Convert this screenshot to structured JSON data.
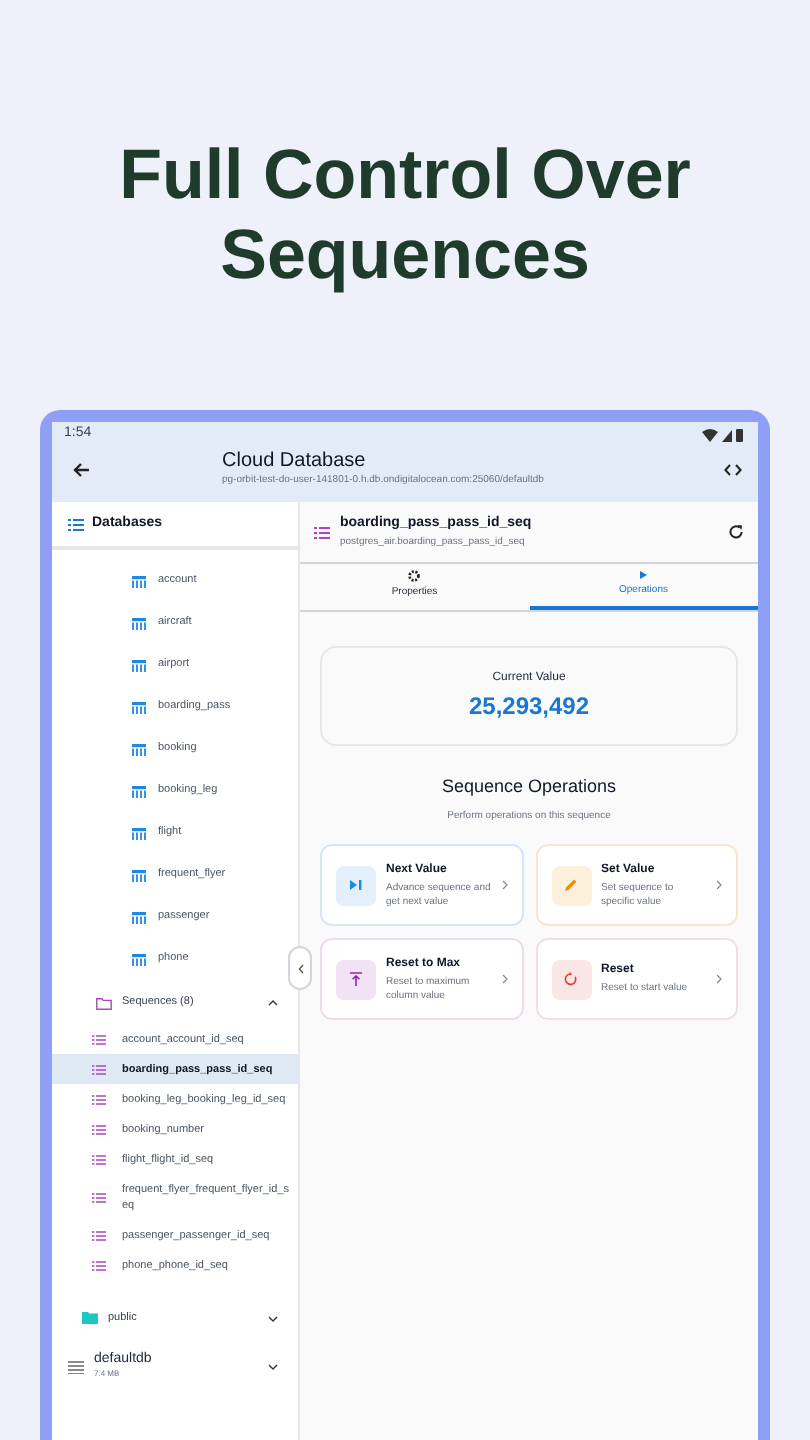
{
  "headline": "Full Control Over Sequences",
  "status_bar": {
    "time": "1:54"
  },
  "app_bar": {
    "title": "Cloud Database",
    "subtitle": "pg-orbit-test-do-user-141801-0.h.db.ondigitalocean.com:25060/defaultdb"
  },
  "sidebar": {
    "title": "Databases",
    "tree": [
      {
        "kind": "table",
        "label": "account"
      },
      {
        "kind": "table",
        "label": "aircraft"
      },
      {
        "kind": "table",
        "label": "airport"
      },
      {
        "kind": "table",
        "label": "boarding_pass"
      },
      {
        "kind": "table",
        "label": "booking"
      },
      {
        "kind": "table",
        "label": "booking_leg"
      },
      {
        "kind": "table",
        "label": "flight"
      },
      {
        "kind": "table",
        "label": "frequent_flyer"
      },
      {
        "kind": "table",
        "label": "passenger"
      },
      {
        "kind": "table",
        "label": "phone"
      },
      {
        "kind": "folder",
        "label": "Sequences (8)",
        "expanded": true,
        "children": [
          {
            "kind": "sequence",
            "label": "account_account_id_seq",
            "selected": false
          },
          {
            "kind": "sequence",
            "label": "boarding_pass_pass_id_seq",
            "selected": true
          },
          {
            "kind": "sequence",
            "label": "booking_leg_booking_leg_id_seq",
            "selected": false
          },
          {
            "kind": "sequence",
            "label": "booking_number",
            "selected": false
          },
          {
            "kind": "sequence",
            "label": "flight_flight_id_seq",
            "selected": false
          },
          {
            "kind": "sequence",
            "label": "frequent_flyer_frequent_flyer_id_seq",
            "selected": false
          },
          {
            "kind": "sequence",
            "label": "passenger_passenger_id_seq",
            "selected": false
          },
          {
            "kind": "sequence",
            "label": "phone_phone_id_seq",
            "selected": false
          }
        ]
      },
      {
        "kind": "schema",
        "label": "public",
        "expanded": false
      },
      {
        "kind": "database",
        "label": "defaultdb",
        "size": "7.4 MB",
        "expanded": false
      }
    ]
  },
  "detail": {
    "title": "boarding_pass_pass_id_seq",
    "subtitle": "postgres_air.boarding_pass_pass_id_seq",
    "tabs": [
      {
        "label": "Properties",
        "selected": false
      },
      {
        "label": "Operations",
        "selected": true
      }
    ],
    "current_value": {
      "label": "Current Value",
      "value": "25,293,492"
    },
    "operations_title": "Sequence Operations",
    "operations_subtitle": "Perform operations on this sequence",
    "operations": [
      {
        "kind": "next",
        "title": "Next Value",
        "description": "Advance sequence and get next value"
      },
      {
        "kind": "set",
        "title": "Set Value",
        "description": "Set sequence to specific value"
      },
      {
        "kind": "max",
        "title": "Reset to Max",
        "description": "Reset to maximum column value"
      },
      {
        "kind": "reset",
        "title": "Reset",
        "description": "Reset to start value"
      }
    ]
  }
}
